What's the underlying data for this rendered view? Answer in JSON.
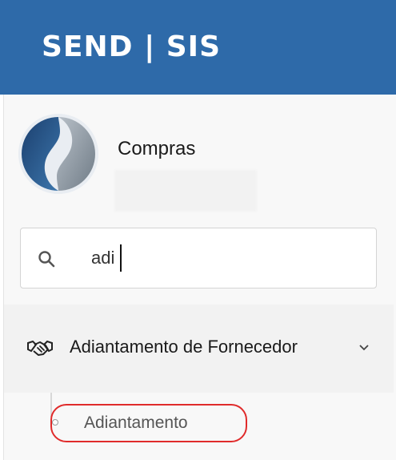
{
  "header": {
    "brand": "SEND | SIS"
  },
  "profile": {
    "name": "Compras"
  },
  "search": {
    "value": "adi",
    "icon": "search-icon"
  },
  "menu": {
    "group_label": "Adiantamento de Fornecedor",
    "group_icon": "handshake-icon",
    "chevron": "chevron-down-icon",
    "items": [
      {
        "label": "Adiantamento"
      }
    ]
  },
  "colors": {
    "header_bg": "#2e6aa9",
    "highlight": "#e02b2b"
  }
}
